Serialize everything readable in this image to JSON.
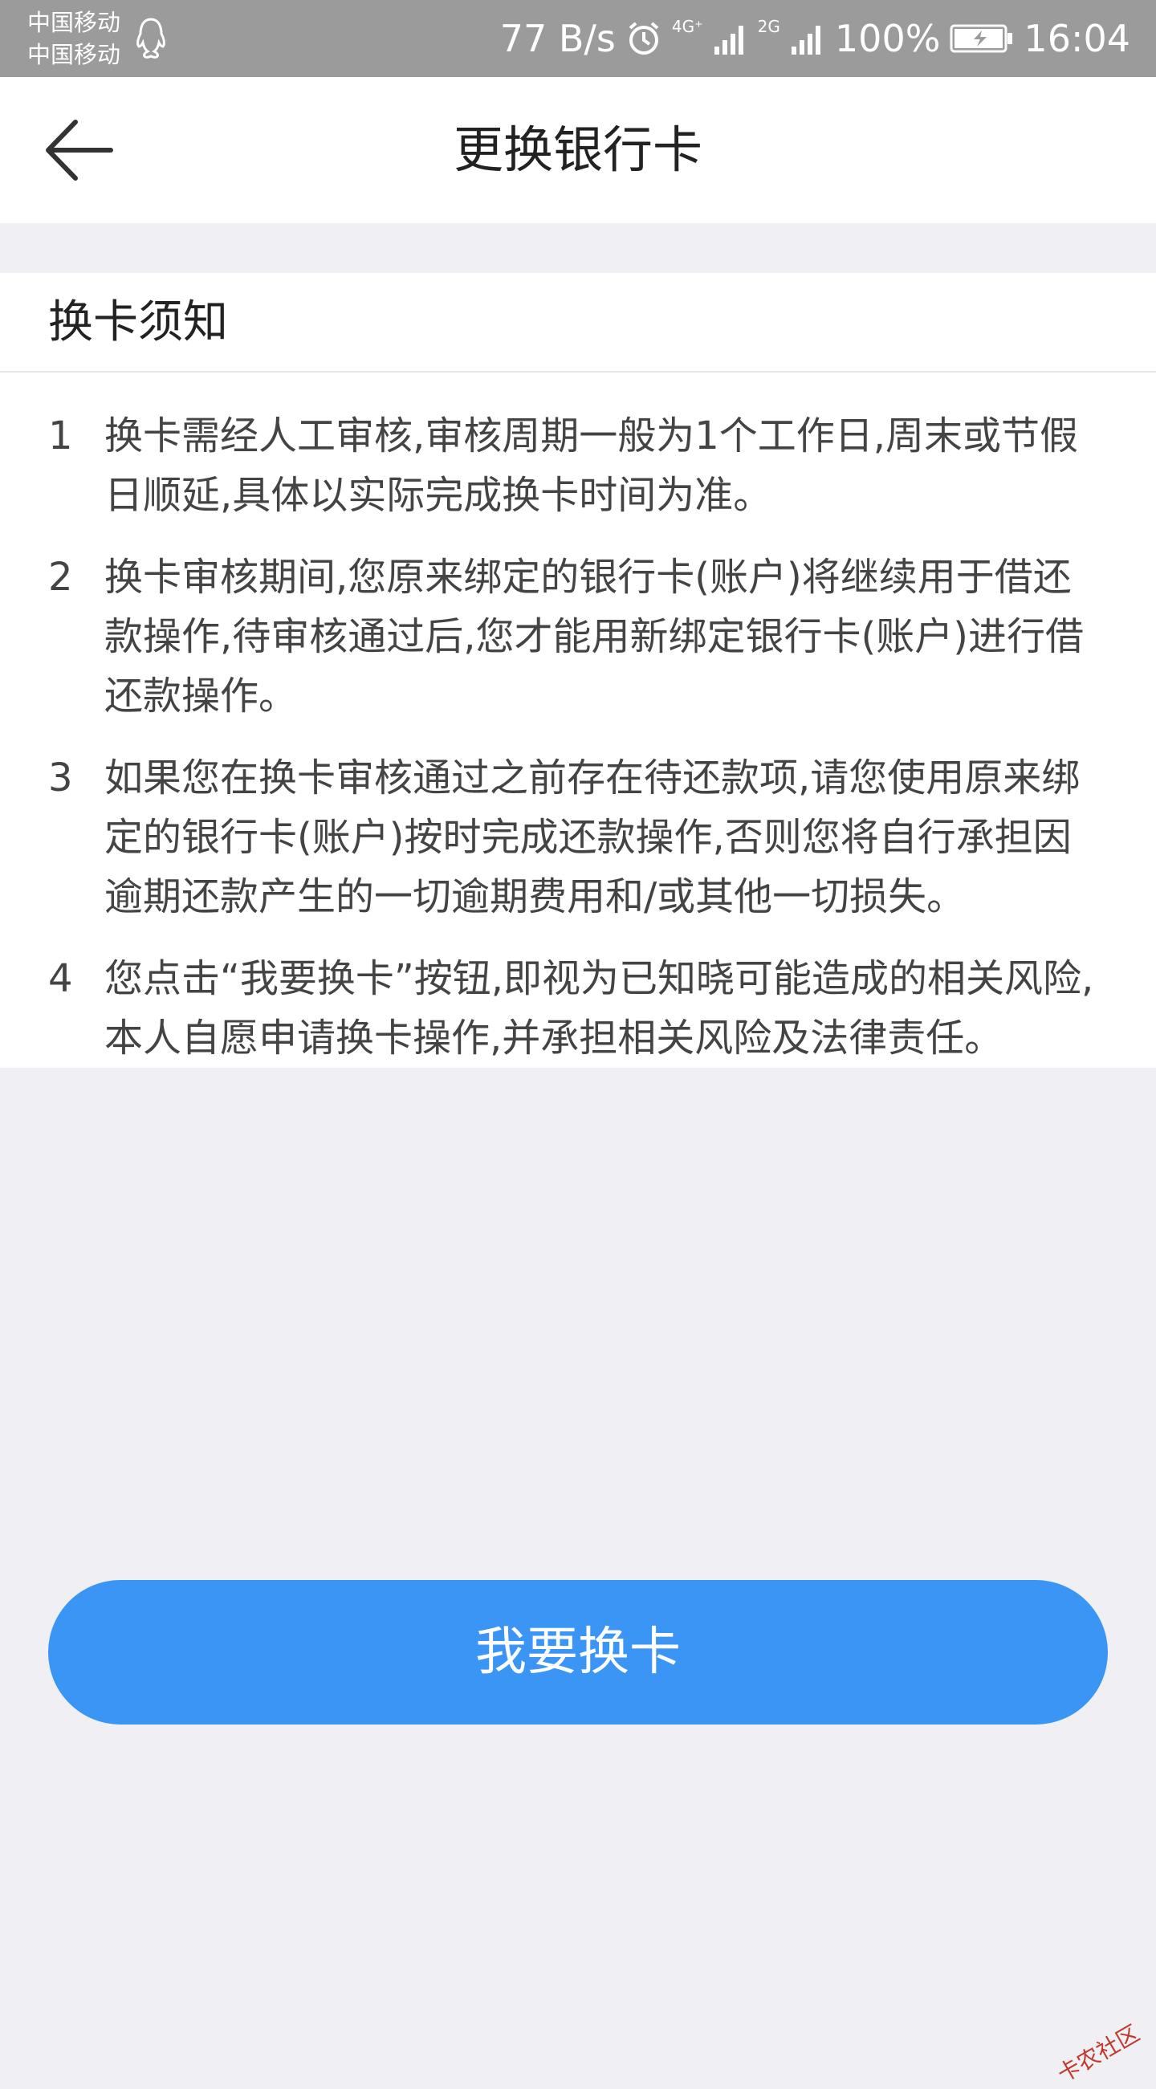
{
  "status_bar": {
    "carrier_1": "中国移动",
    "carrier_2": "中国移动",
    "net_speed": "77 B/s",
    "network_1": "4G⁺",
    "network_2": "2G",
    "battery": "100%",
    "time": "16:04",
    "icons": [
      "qq-icon",
      "alarm-icon",
      "signal-icon",
      "signal-icon",
      "battery-charging-icon"
    ]
  },
  "header": {
    "title": "更换银行卡",
    "back_icon": "back-arrow-icon"
  },
  "notice": {
    "title": "换卡须知",
    "items": [
      {
        "num": "1",
        "text": "换卡需经人工审核,审核周期一般为1个工作日,周末或节假日顺延,具体以实际完成换卡时间为准。"
      },
      {
        "num": "2",
        "text": "换卡审核期间,您原来绑定的银行卡(账户)将继续用于借还款操作,待审核通过后,您才能用新绑定银行卡(账户)进行借还款操作。"
      },
      {
        "num": "3",
        "text": "如果您在换卡审核通过之前存在待还款项,请您使用原来绑定的银行卡(账户)按时完成还款操作,否则您将自行承担因逾期还款产生的一切逾期费用和/或其他一切损失。"
      },
      {
        "num": "4",
        "text": "您点击“我要换卡”按钮,即视为已知晓可能造成的相关风险,本人自愿申请换卡操作,并承担相关风险及法律责任。"
      }
    ]
  },
  "action": {
    "button_label": "我要换卡"
  },
  "watermark": {
    "text": "卡农社区"
  },
  "colors": {
    "primary": "#3a95f5",
    "status_bar": "#9b9b9b",
    "background": "#efeff4"
  }
}
